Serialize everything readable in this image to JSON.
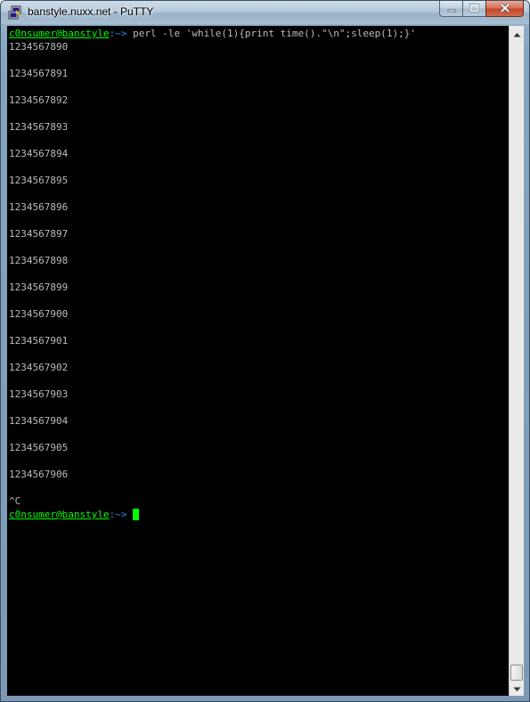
{
  "window": {
    "title": "banstyle.nuxx.net - PuTTY"
  },
  "terminal": {
    "prompt_user": "c0nsumer@banstyle",
    "prompt_path": ":~>",
    "command": "perl -le 'while(1){print time().\"\\n\";sleep(1);}'",
    "output": [
      "1234567890",
      "1234567891",
      "1234567892",
      "1234567893",
      "1234567894",
      "1234567895",
      "1234567896",
      "1234567897",
      "1234567898",
      "1234567899",
      "1234567900",
      "1234567901",
      "1234567902",
      "1234567903",
      "1234567904",
      "1234567905",
      "1234567906"
    ],
    "interrupt": "^C"
  },
  "colors": {
    "background": "#000000",
    "text": "#bbbbbb",
    "user": "#00ff00",
    "path": "#1e90ff",
    "cursor": "#00ff00"
  },
  "icons": {
    "app": "putty-icon",
    "minimize": "minimize-icon",
    "maximize": "maximize-icon",
    "close": "close-icon"
  }
}
